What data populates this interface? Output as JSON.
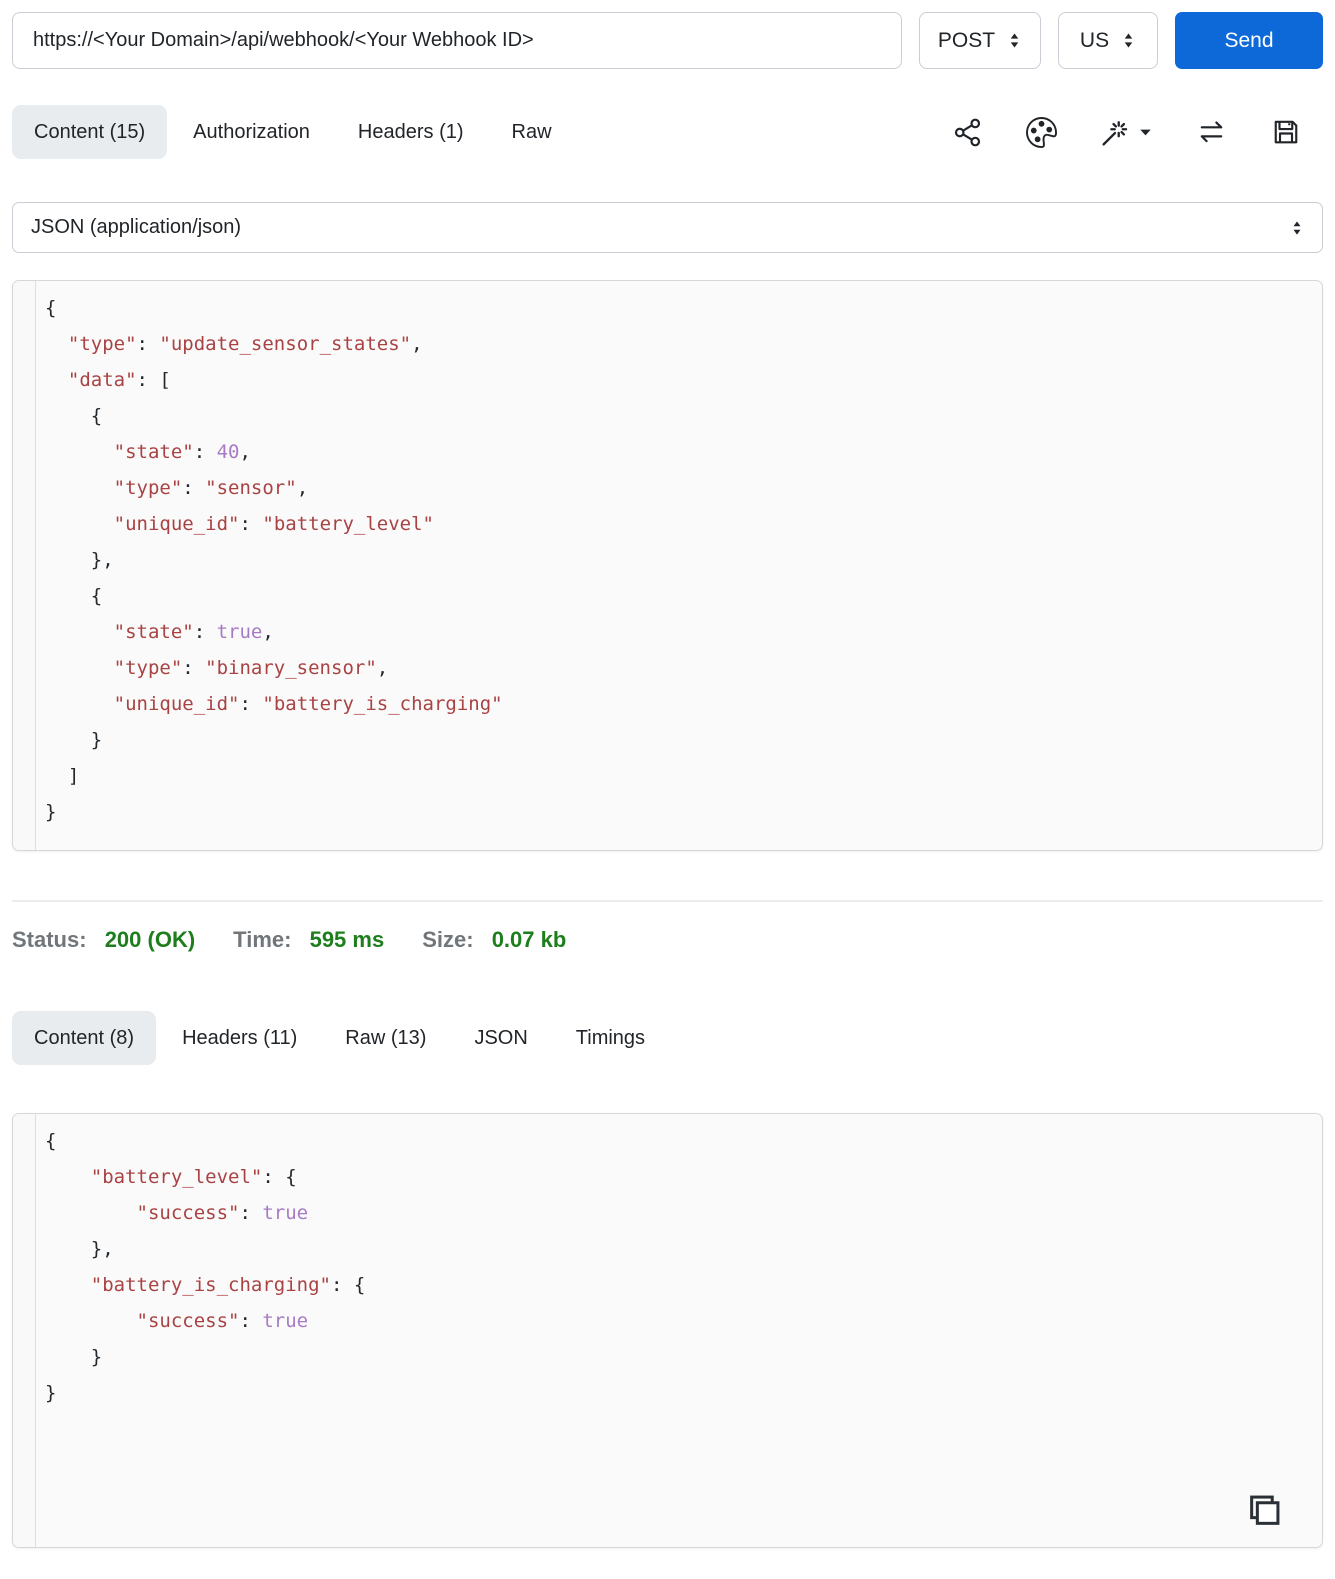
{
  "request": {
    "url": "https://<Your Domain>/api/webhook/<Your Webhook ID>",
    "method": "POST",
    "region": "US",
    "send_label": "Send",
    "tabs": [
      {
        "label": "Content (15)",
        "active": true
      },
      {
        "label": "Authorization",
        "active": false
      },
      {
        "label": "Headers (1)",
        "active": false
      },
      {
        "label": "Raw",
        "active": false
      }
    ],
    "toolbar_icons": [
      "share-icon",
      "palette-icon",
      "magic-wand-icon",
      "swap-arrows-icon",
      "save-icon"
    ],
    "content_type": "JSON (application/json)",
    "body_lines": [
      [
        [
          "{",
          "p"
        ]
      ],
      [
        [
          "  ",
          "p"
        ],
        [
          "\"type\"",
          "s"
        ],
        [
          ": ",
          "p"
        ],
        [
          "\"update_sensor_states\"",
          "s"
        ],
        [
          ",",
          "p"
        ]
      ],
      [
        [
          "  ",
          "p"
        ],
        [
          "\"data\"",
          "s"
        ],
        [
          ": [",
          "p"
        ]
      ],
      [
        [
          "    {",
          "p"
        ]
      ],
      [
        [
          "      ",
          "p"
        ],
        [
          "\"state\"",
          "s"
        ],
        [
          ": ",
          "p"
        ],
        [
          "40",
          "l"
        ],
        [
          ",",
          "p"
        ]
      ],
      [
        [
          "      ",
          "p"
        ],
        [
          "\"type\"",
          "s"
        ],
        [
          ": ",
          "p"
        ],
        [
          "\"sensor\"",
          "s"
        ],
        [
          ",",
          "p"
        ]
      ],
      [
        [
          "      ",
          "p"
        ],
        [
          "\"unique_id\"",
          "s"
        ],
        [
          ": ",
          "p"
        ],
        [
          "\"battery_level\"",
          "s"
        ]
      ],
      [
        [
          "    },",
          "p"
        ]
      ],
      [
        [
          "    {",
          "p"
        ]
      ],
      [
        [
          "      ",
          "p"
        ],
        [
          "\"state\"",
          "s"
        ],
        [
          ": ",
          "p"
        ],
        [
          "true",
          "l"
        ],
        [
          ",",
          "p"
        ]
      ],
      [
        [
          "      ",
          "p"
        ],
        [
          "\"type\"",
          "s"
        ],
        [
          ": ",
          "p"
        ],
        [
          "\"binary_sensor\"",
          "s"
        ],
        [
          ",",
          "p"
        ]
      ],
      [
        [
          "      ",
          "p"
        ],
        [
          "\"unique_id\"",
          "s"
        ],
        [
          ": ",
          "p"
        ],
        [
          "\"battery_is_charging\"",
          "s"
        ]
      ],
      [
        [
          "    }",
          "p"
        ]
      ],
      [
        [
          "  ]",
          "p"
        ]
      ],
      [
        [
          "}",
          "p"
        ]
      ]
    ]
  },
  "response": {
    "status_label": "Status:",
    "status_value": "200 (OK)",
    "time_label": "Time:",
    "time_value": "595 ms",
    "size_label": "Size:",
    "size_value": "0.07 kb",
    "tabs": [
      {
        "label": "Content (8)",
        "active": true
      },
      {
        "label": "Headers (11)",
        "active": false
      },
      {
        "label": "Raw (13)",
        "active": false
      },
      {
        "label": "JSON",
        "active": false
      },
      {
        "label": "Timings",
        "active": false
      }
    ],
    "body_lines": [
      [
        [
          "{",
          "p"
        ]
      ],
      [
        [
          "    ",
          "p"
        ],
        [
          "\"battery_level\"",
          "s"
        ],
        [
          ": {",
          "p"
        ]
      ],
      [
        [
          "        ",
          "p"
        ],
        [
          "\"success\"",
          "s"
        ],
        [
          ": ",
          "p"
        ],
        [
          "true",
          "l"
        ]
      ],
      [
        [
          "    },",
          "p"
        ]
      ],
      [
        [
          "    ",
          "p"
        ],
        [
          "\"battery_is_charging\"",
          "s"
        ],
        [
          ": {",
          "p"
        ]
      ],
      [
        [
          "        ",
          "p"
        ],
        [
          "\"success\"",
          "s"
        ],
        [
          ": ",
          "p"
        ],
        [
          "true",
          "l"
        ]
      ],
      [
        [
          "    }",
          "p"
        ]
      ],
      [
        [
          "}",
          "p"
        ]
      ]
    ]
  },
  "colors": {
    "accent_blue": "#0d68d8",
    "status_green": "#1e7e1e",
    "label_gray": "#71767b",
    "active_tab_bg": "#e9ecef",
    "code_string_red": "#a94243",
    "code_literal_purple": "#a77bc4",
    "code_punctuation": "#23282d",
    "code_background": "#fafafa"
  }
}
